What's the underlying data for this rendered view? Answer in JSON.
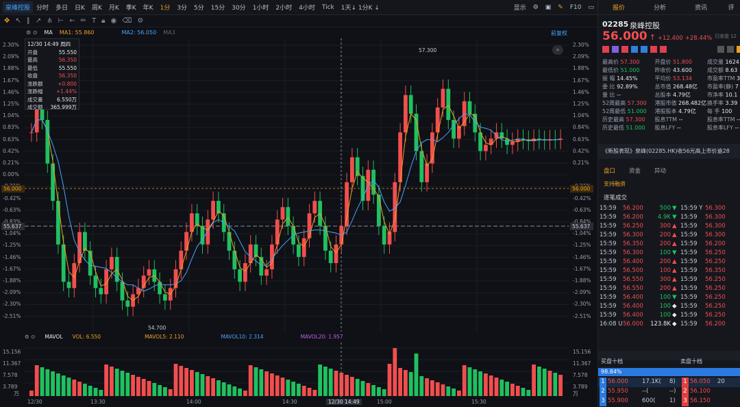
{
  "topbar": {
    "stock": "泉峰控股",
    "items": [
      "分时",
      "多日",
      "日K",
      "周K",
      "月K",
      "季K",
      "年K",
      "1分",
      "3分",
      "5分",
      "15分",
      "30分",
      "1小时",
      "2小时",
      "4小时",
      "Tick",
      "1天↓ 1分K ↓"
    ],
    "active": "1分",
    "right": [
      "形态",
      "显示",
      "F10"
    ]
  },
  "toolbar": {
    "right_label": "前复权"
  },
  "ma": {
    "label": "MA",
    "ma1": "MA1: 55.860",
    "ma2": "MA2: 56.050",
    "ma3": "MA3"
  },
  "infobox": {
    "date": "12/30 14:49 周四",
    "rows": [
      [
        "开盘",
        "55.550"
      ],
      [
        "最高",
        "56.350"
      ],
      [
        "最低",
        "55.550"
      ],
      [
        "收盘",
        "56.350"
      ],
      [
        "涨跌额",
        "+0.800"
      ],
      [
        "涨跌幅",
        "+1.44%"
      ],
      [
        "成交量",
        "6.550万"
      ],
      [
        "成交额",
        "365.999万"
      ]
    ]
  },
  "y_left": [
    "2.30%",
    "2.09%",
    "1.88%",
    "1.67%",
    "1.46%",
    "1.25%",
    "1.04%",
    "0.83%",
    "0.63%",
    "0.42%",
    "0.21%",
    "0.00%",
    "-0.21%",
    "-0.42%",
    "-0.63%",
    "-0.83%",
    "-1.04%",
    "-1.25%",
    "-1.46%",
    "-1.67%",
    "-1.88%",
    "-2.09%",
    "-2.30%",
    "-2.51%"
  ],
  "y_left_prices": {
    "p56": "56.000",
    "p5563": "55.637"
  },
  "y_right": [
    "2.30%",
    "2.09%",
    "1.88%",
    "1.67%",
    "1.46%",
    "1.25%",
    "1.04%",
    "0.84%",
    "0.63%",
    "0.42%",
    "0.21%",
    "",
    "-0.21%",
    "-0.42%",
    "-0.63%",
    "-0.84%",
    "-1.04%",
    "-1.25%",
    "-1.46%",
    "-1.67%",
    "-1.88%",
    "-2.09%",
    "-2.30%",
    "-2.51%"
  ],
  "y_right_prices": {
    "p56": "56.000",
    "p5563": "55.637"
  },
  "annotations": {
    "high": "57.300",
    "low": "54.700"
  },
  "vol": {
    "label": "MAVOL",
    "vol": "VOL: 6.550",
    "mavol5": "MAVOL5: 2.110",
    "mavol10": "MAVOL10: 2.314",
    "mavol20": "MAVOL20: 1.957",
    "y": [
      "15.156",
      "11.367",
      "7.578",
      "3.789"
    ],
    "unit": "万"
  },
  "xaxis": [
    "12/30",
    "13:30",
    "14:00",
    "14:30",
    "12/30 14:49",
    "15:00",
    "15:30"
  ],
  "rpanel": {
    "tabs": [
      "报价",
      "分析",
      "资讯",
      "评"
    ],
    "code": "02285",
    "name": "泉峰控股",
    "price": "56.000",
    "arrow": "↑",
    "chg": "+12.400",
    "pct": "+28.44%",
    "status": "已收盘 12",
    "quote_rows": [
      [
        [
          "最高价",
          "57.300"
        ],
        [
          "开盘价",
          "51.800"
        ],
        [
          "成交量",
          "1624"
        ]
      ],
      [
        [
          "最低价",
          "51.000"
        ],
        [
          "昨收价",
          "43.600"
        ],
        [
          "成交额",
          "8.63"
        ]
      ],
      [
        [
          "振  幅",
          "14.45%"
        ],
        [
          "平均价",
          "53.134"
        ],
        [
          "市盈率TTM",
          "3"
        ]
      ],
      [
        [
          "委  比",
          "92.89%"
        ],
        [
          "总市值",
          "268.48亿"
        ],
        [
          "市盈率(静)",
          "7"
        ]
      ],
      [
        [
          "量  比",
          "--"
        ],
        [
          "总股本",
          "4.79亿"
        ],
        [
          "市净率",
          "10.1"
        ]
      ],
      [
        [
          "52周最高",
          "57.300"
        ],
        [
          "港股市值",
          "268.482亿"
        ],
        [
          "换手率",
          "3.39"
        ]
      ],
      [
        [
          "52周最低",
          "51.000"
        ],
        [
          "港股股本",
          "4.79亿"
        ],
        [
          "每  手",
          "100"
        ]
      ],
      [
        [
          "历史最高",
          "57.300"
        ],
        [
          "股息TTM",
          "--"
        ],
        [
          "股息率TTM",
          "--"
        ]
      ],
      [
        [
          "历史最低",
          "51.000"
        ],
        [
          "股息LFY",
          "--"
        ],
        [
          "股息率LFY",
          "--"
        ]
      ]
    ],
    "news": "《新股表现》泉峰(02285.HK)收56元高上市价逾28",
    "subtabs": [
      "盘口",
      "资金",
      "异动"
    ],
    "support": "支持融资",
    "trades_title": "逐笔成交",
    "trades_left": [
      [
        "15:59",
        "56.200",
        "500",
        "down"
      ],
      [
        "15:59",
        "56.200",
        "4.9K",
        "down"
      ],
      [
        "15:59",
        "56.250",
        "300",
        "up"
      ],
      [
        "15:59",
        "56.300",
        "200",
        "up"
      ],
      [
        "15:59",
        "56.350",
        "200",
        "up"
      ],
      [
        "15:59",
        "56.300",
        "100",
        "down"
      ],
      [
        "15:59",
        "56.400",
        "200",
        "up"
      ],
      [
        "15:59",
        "56.500",
        "100",
        "up"
      ],
      [
        "15:59",
        "56.550",
        "300",
        "up"
      ],
      [
        "15:59",
        "56.550",
        "200",
        "up"
      ],
      [
        "15:59",
        "56.400",
        "100",
        "down"
      ],
      [
        "15:59",
        "56.400",
        "100",
        "dot"
      ],
      [
        "15:59",
        "56.400",
        "100",
        "dot"
      ],
      [
        "16:08 U",
        "56.000",
        "123.8K",
        "dot"
      ]
    ],
    "trades_right": [
      [
        "15:59 Y",
        "56.300"
      ],
      [
        "15:59",
        "56.300"
      ],
      [
        "15:59",
        "56.300"
      ],
      [
        "15:59",
        "56.300"
      ],
      [
        "15:59",
        "56.200"
      ],
      [
        "15:59",
        "56.250"
      ],
      [
        "15:59",
        "56.250"
      ],
      [
        "15:59",
        "56.350"
      ],
      [
        "15:59",
        "56.250"
      ],
      [
        "15:59",
        "56.250"
      ],
      [
        "15:59",
        "56.250"
      ],
      [
        "15:59",
        "56.250"
      ],
      [
        "15:59",
        "56.250"
      ],
      [
        "15:59",
        "56.200"
      ]
    ],
    "buy10": "买盘十档",
    "sell10": "卖盘十档",
    "ratio": "98.84%",
    "bids": [
      [
        "1",
        "56.000",
        "17.1K(",
        "8)"
      ],
      [
        "2",
        "55.950",
        "--(",
        "--)"
      ],
      [
        "3",
        "55.900",
        "600(",
        "1)"
      ]
    ],
    "asks": [
      [
        "1",
        "56.050",
        "20"
      ],
      [
        "2",
        "56.100",
        ""
      ],
      [
        "3",
        "56.150",
        ""
      ]
    ]
  }
}
